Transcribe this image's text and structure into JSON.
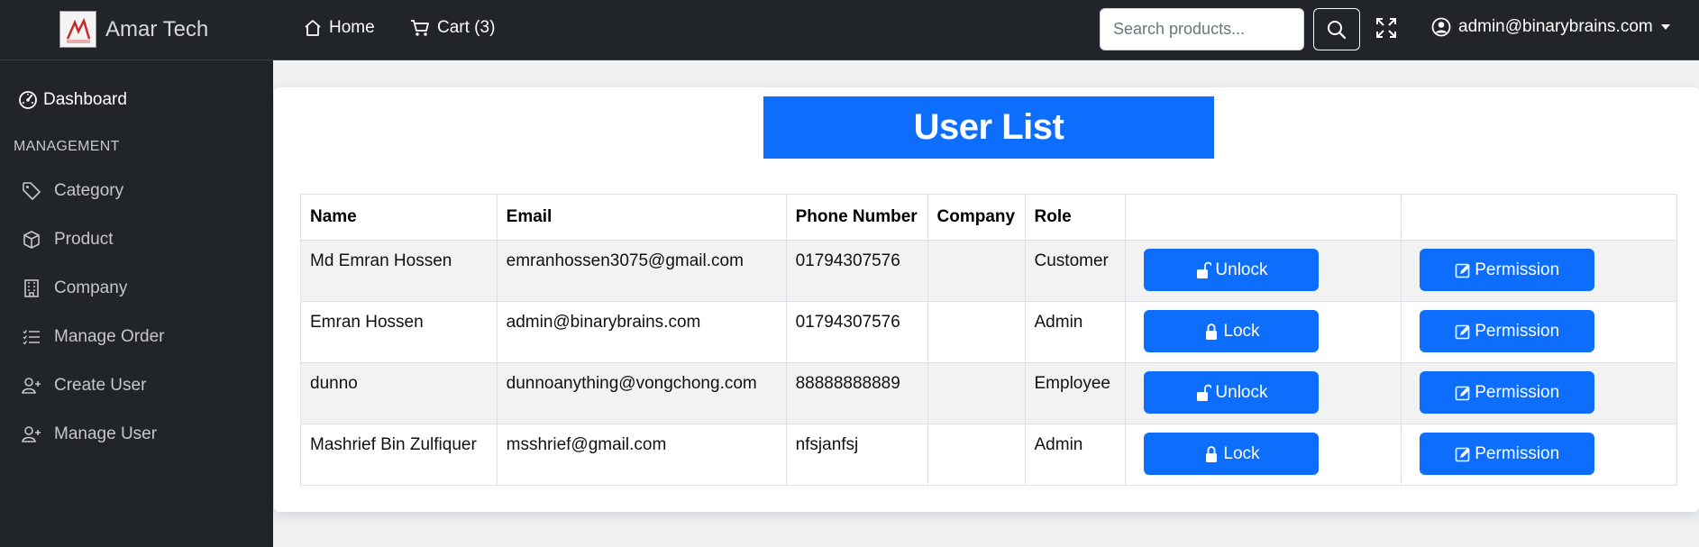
{
  "navbar": {
    "brand": "Amar Tech",
    "logo_text": "AMAR TECH",
    "home_label": "Home",
    "cart_label": "Cart (3)",
    "search_placeholder": "Search products...",
    "user_email": "admin@binarybrains.com"
  },
  "sidebar": {
    "dashboard_label": "Dashboard",
    "heading": "MANAGEMENT",
    "items": [
      {
        "label": "Category",
        "icon": "tag-icon"
      },
      {
        "label": "Product",
        "icon": "box-icon"
      },
      {
        "label": "Company",
        "icon": "building-icon"
      },
      {
        "label": "Manage Order",
        "icon": "list-icon"
      },
      {
        "label": "Create User",
        "icon": "user-plus-icon"
      },
      {
        "label": "Manage User",
        "icon": "user-plus-icon"
      }
    ]
  },
  "main": {
    "title": "User List",
    "columns": [
      "Name",
      "Email",
      "Phone Number",
      "Company",
      "Role",
      "",
      ""
    ],
    "rows": [
      {
        "name": "Md Emran Hossen",
        "email": "emranhossen3075@gmail.com",
        "phone": "01794307576",
        "company": "",
        "role": "Customer",
        "lock_label": "Unlock",
        "lock_icon": "unlock-icon",
        "perm_label": "Permission"
      },
      {
        "name": "Emran Hossen",
        "email": "admin@binarybrains.com",
        "phone": "01794307576",
        "company": "",
        "role": "Admin",
        "lock_label": "Lock",
        "lock_icon": "lock-icon",
        "perm_label": "Permission"
      },
      {
        "name": "dunno",
        "email": "dunnoanything@vongchong.com",
        "phone": "88888888889",
        "company": "",
        "role": "Employee",
        "lock_label": "Unlock",
        "lock_icon": "unlock-icon",
        "perm_label": "Permission"
      },
      {
        "name": "Mashrief Bin Zulfiquer",
        "email": "msshrief@gmail.com",
        "phone": "nfsjanfsj",
        "company": "",
        "role": "Admin",
        "lock_label": "Lock",
        "lock_icon": "lock-icon",
        "perm_label": "Permission"
      }
    ]
  },
  "colors": {
    "primary": "#0d6efd",
    "dark": "#212529"
  }
}
